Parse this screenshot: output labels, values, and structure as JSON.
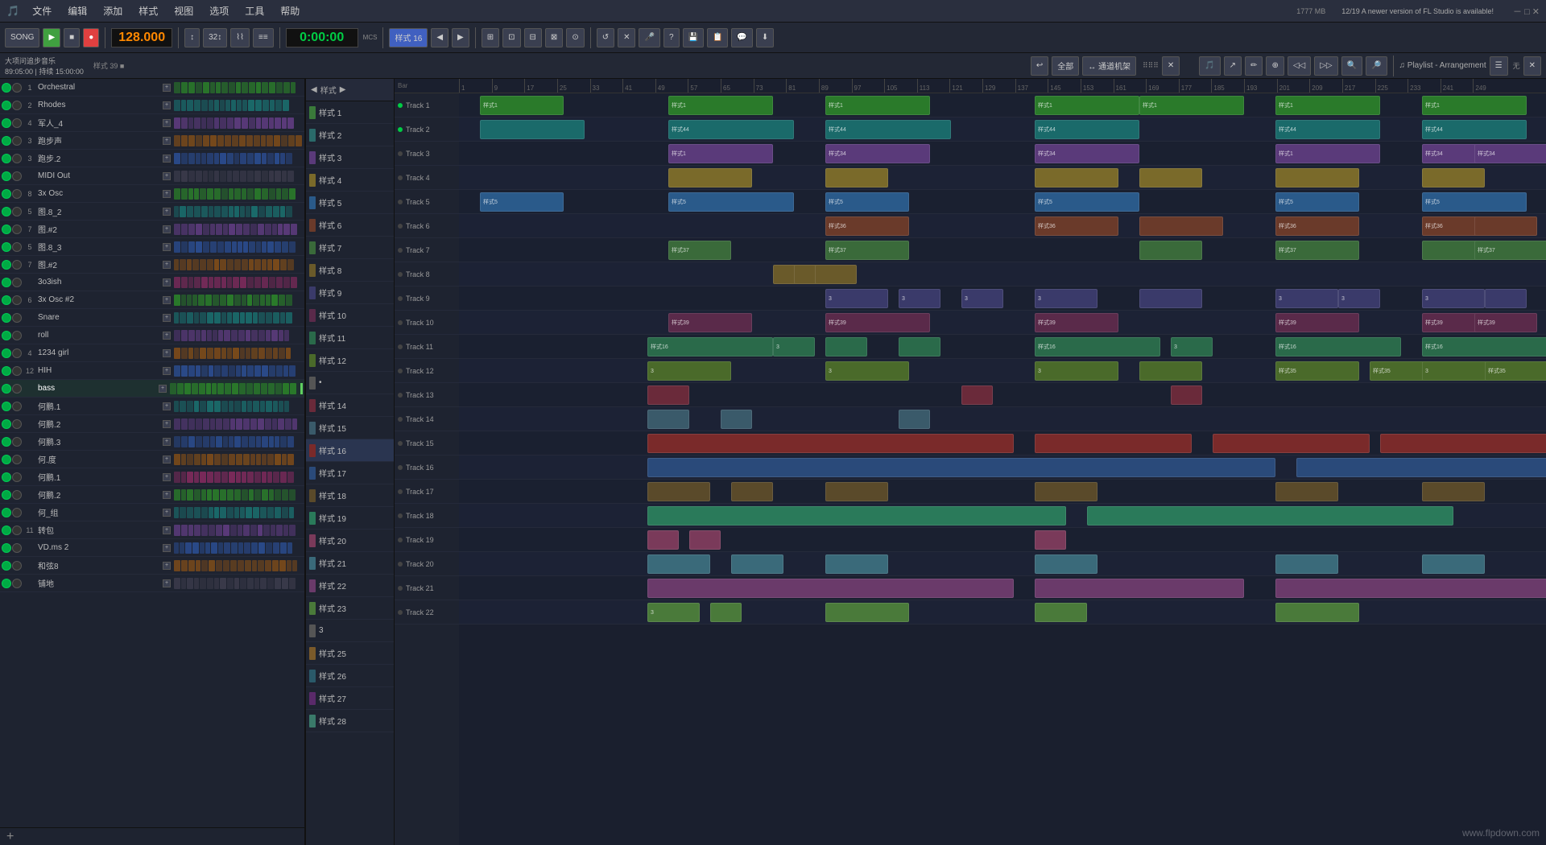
{
  "app": {
    "title": "FL Studio",
    "menu_items": [
      "文件",
      "编辑",
      "添加",
      "样式",
      "视图",
      "选项",
      "工具",
      "帮助"
    ]
  },
  "toolbar": {
    "bpm": "128.000",
    "time": "0:00:00",
    "song_label": "SONG",
    "play_icon": "▶",
    "stop_icon": "■",
    "record_icon": "●",
    "pattern_label": "样式 16",
    "memory": "1777 MB",
    "version_notice": "12/19  A newer version of FL Studio is available!"
  },
  "left_panel": {
    "title": "通道机架",
    "subtitle": "全部",
    "info": "大项问追步音乐\n89:05:00 | 持续 15:00:00",
    "style_label": "样式 39",
    "channels": [
      {
        "num": "1",
        "name": "Orchestral",
        "color": "green"
      },
      {
        "num": "2",
        "name": "Rhodes",
        "color": "teal"
      },
      {
        "num": "4",
        "name": "军人_4",
        "color": "purple"
      },
      {
        "num": "3",
        "name": "跑步声",
        "color": "orange"
      },
      {
        "num": "3",
        "name": "跑步.2",
        "color": "blue"
      },
      {
        "num": "",
        "name": "MIDI Out",
        "color": "gray"
      },
      {
        "num": "8",
        "name": "3x Osc",
        "color": "green"
      },
      {
        "num": "5",
        "name": "图.8_2",
        "color": "teal"
      },
      {
        "num": "7",
        "name": "图.#2",
        "color": "purple"
      },
      {
        "num": "5",
        "name": "图.8_3",
        "color": "blue"
      },
      {
        "num": "7",
        "name": "图.#2",
        "color": "orange"
      },
      {
        "num": "",
        "name": "3o3ish",
        "color": "pink"
      },
      {
        "num": "6",
        "name": "3x Osc #2",
        "color": "green"
      },
      {
        "num": "",
        "name": "Snare",
        "color": "teal"
      },
      {
        "num": "",
        "name": "roll",
        "color": "purple"
      },
      {
        "num": "4",
        "name": "1234 girl",
        "color": "orange"
      },
      {
        "num": "12",
        "name": "HIH",
        "color": "blue"
      },
      {
        "num": "",
        "name": "bass",
        "color": "green",
        "highlighted": true
      },
      {
        "num": "",
        "name": "何鹏.1",
        "color": "teal"
      },
      {
        "num": "",
        "name": "何鹏.2",
        "color": "purple"
      },
      {
        "num": "",
        "name": "何鹏.3",
        "color": "blue"
      },
      {
        "num": "",
        "name": "何.度",
        "color": "orange"
      },
      {
        "num": "",
        "name": "何鹏.1",
        "color": "pink"
      },
      {
        "num": "",
        "name": "何鹏.2",
        "color": "green"
      },
      {
        "num": "",
        "name": "何_组",
        "color": "teal"
      },
      {
        "num": "11",
        "name": "转包",
        "color": "purple"
      },
      {
        "num": "",
        "name": "VD.ms 2",
        "color": "blue"
      },
      {
        "num": "",
        "name": "和弦8",
        "color": "orange"
      },
      {
        "num": "",
        "name": "铺地",
        "color": "gray"
      }
    ]
  },
  "pattern_list": {
    "patterns": [
      {
        "name": "样式 1",
        "color": "#3a7a3a"
      },
      {
        "name": "样式 2",
        "color": "#2a6a6a"
      },
      {
        "name": "样式 3",
        "color": "#5a3a7a"
      },
      {
        "name": "样式 4",
        "color": "#7a6a2a"
      },
      {
        "name": "样式 5",
        "color": "#2a5a8a"
      },
      {
        "name": "样式 6",
        "color": "#6a3a2a"
      },
      {
        "name": "样式 7",
        "color": "#3a6a3a"
      },
      {
        "name": "样式 8",
        "color": "#6a5a2a"
      },
      {
        "name": "样式 9",
        "color": "#3a3a6a"
      },
      {
        "name": "样式 10",
        "color": "#5a2a4a"
      },
      {
        "name": "样式 11",
        "color": "#2a6a4a"
      },
      {
        "name": "样式 12",
        "color": "#4a6a2a"
      },
      {
        "name": "•",
        "color": "#555"
      },
      {
        "name": "样式 14",
        "color": "#6a2a3a"
      },
      {
        "name": "样式 15",
        "color": "#3a5a6a"
      },
      {
        "name": "样式 16",
        "color": "#7a2a2a",
        "active": true
      },
      {
        "name": "样式 17",
        "color": "#2a4a7a"
      },
      {
        "name": "样式 18",
        "color": "#5a4a2a"
      },
      {
        "name": "样式 19",
        "color": "#2a7a5a"
      },
      {
        "name": "样式 20",
        "color": "#7a3a5a"
      },
      {
        "name": "样式 21",
        "color": "#3a6a7a"
      },
      {
        "name": "样式 22",
        "color": "#6a3a6a"
      },
      {
        "name": "样式 23",
        "color": "#4a7a3a"
      },
      {
        "name": "3",
        "color": "#555"
      },
      {
        "name": "样式 25",
        "color": "#7a5a2a"
      },
      {
        "name": "样式 26",
        "color": "#2a5a6a"
      },
      {
        "name": "样式 27",
        "color": "#5a2a6a"
      },
      {
        "name": "样式 28",
        "color": "#3a7a6a"
      }
    ]
  },
  "playlist": {
    "title": "Playlist - Arrangement",
    "tracks": [
      "Track 1",
      "Track 2",
      "Track 3",
      "Track 4",
      "Track 5",
      "Track 6",
      "Track 7",
      "Track 8",
      "Track 9",
      "Track 10",
      "Track 11",
      "Track 12",
      "Track 13",
      "Track 14",
      "Track 15",
      "Track 16",
      "Track 17",
      "Track 18",
      "Track 19",
      "Track 20",
      "Track 21",
      "Track 22"
    ],
    "ruler_marks": [
      "1",
      "9",
      "17",
      "25",
      "33",
      "41",
      "49",
      "57",
      "65",
      "73",
      "81",
      "89",
      "97",
      "105",
      "113",
      "121",
      "129",
      "137",
      "145",
      "153",
      "161",
      "169",
      "177",
      "185",
      "193",
      "201",
      "209",
      "217",
      "225",
      "233",
      "241",
      "249"
    ]
  },
  "status_bar": {
    "info": "大项问追步音乐 | 89:05:00 | 持续 15:00:00 | 样式 39"
  },
  "watermark": "www.flpdown.com"
}
